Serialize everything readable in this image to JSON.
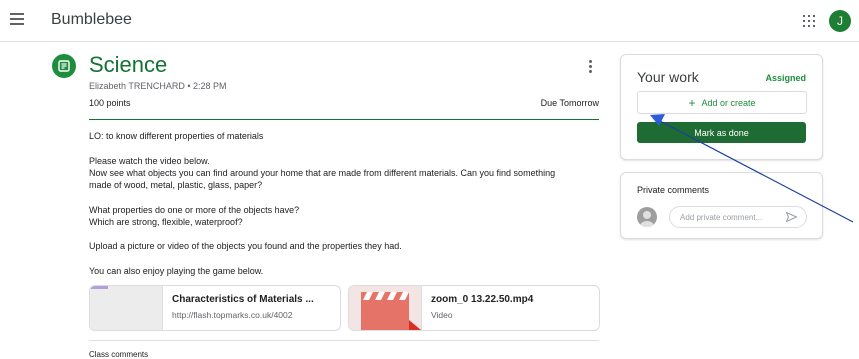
{
  "app": {
    "name": "Bumblebee",
    "avatar_initial": "J"
  },
  "assignment": {
    "title": "Science",
    "meta": "Elizabeth TRENCHARD • 2:28 PM",
    "points": "100 points",
    "due": "Due Tomorrow",
    "description": [
      "LO: to know different properties of materials",
      "Please watch the video below.",
      "Now see what objects you can find around your home that are made from different materials. Can you find something",
      "made of wood, metal, plastic, glass, paper?",
      "What properties do one or more of the objects have?",
      "Which are strong, flexible, waterproof?",
      "Upload a picture or video of the objects you found and the properties they had.",
      "You can also enjoy playing the game below."
    ]
  },
  "attachments": [
    {
      "title": "Characteristics of Materials ...",
      "subtitle": "http://flash.topmarks.co.uk/4002"
    },
    {
      "title": "zoom_0 13.22.50.mp4",
      "subtitle": "Video"
    }
  ],
  "class_comments_label": "Class comments",
  "your_work": {
    "title": "Your work",
    "status": "Assigned",
    "add_label": "Add or create",
    "mark_done_label": "Mark as done"
  },
  "private_comments": {
    "title": "Private comments",
    "placeholder": "Add private comment..."
  },
  "colors": {
    "brand_green": "#1e8e3e",
    "title_green": "#137333",
    "button_green": "#1e6b33",
    "annotation_blue": "#1a3fa0"
  }
}
